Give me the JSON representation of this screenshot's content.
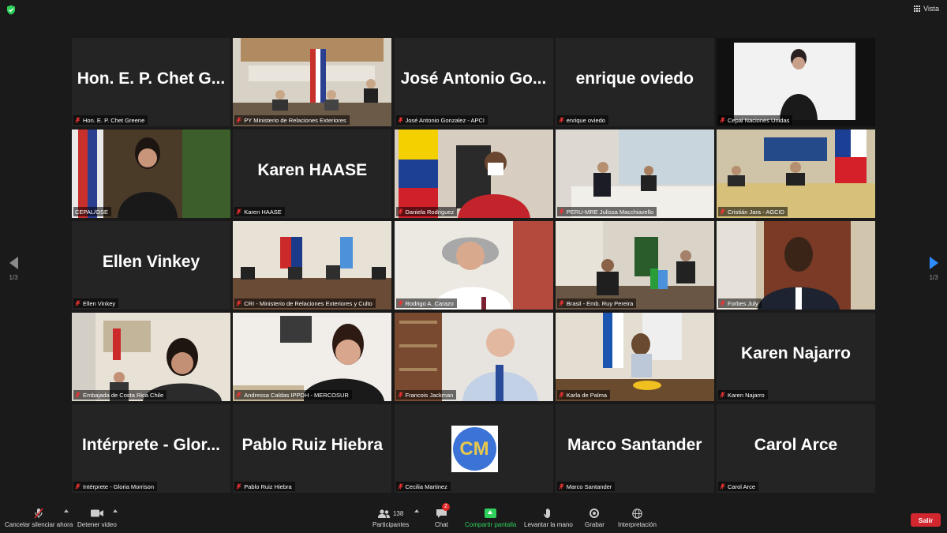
{
  "topbar": {
    "view_label": "Vista"
  },
  "pagination": {
    "left": "1/3",
    "right": "1/3"
  },
  "tiles": [
    {
      "big_name": "Hon. E. P. Chet G...",
      "label": "Hon. E. P. Chet Greene",
      "type": "name"
    },
    {
      "label": "PY Ministerio de Relaciones Exteriores",
      "type": "video"
    },
    {
      "big_name": "José Antonio Go...",
      "label": "José Antonio Gonzalez - APCI",
      "type": "name"
    },
    {
      "big_name": "enrique oviedo",
      "label": "enrique oviedo",
      "type": "name"
    },
    {
      "label": "Cepal Naciones Unidas",
      "type": "video"
    },
    {
      "label": "CEPAL/OSE",
      "type": "video",
      "active": true
    },
    {
      "big_name": "Karen HAASE",
      "label": "Karen HAASE",
      "type": "name"
    },
    {
      "label": "Daniela Rodriguez",
      "type": "video"
    },
    {
      "label": "PERU-MRE Julissa Macchiavello",
      "type": "video"
    },
    {
      "label": "Cristián Jara - AGCID",
      "type": "video"
    },
    {
      "big_name": "Ellen Vinkey",
      "label": "Ellen Vinkey",
      "type": "name"
    },
    {
      "label": "CRI - Ministerio de Relaciones Exteriores y Culto",
      "type": "video"
    },
    {
      "label": "Rodrigo A. Carazo",
      "type": "video"
    },
    {
      "label": "Brasil - Emb. Ruy Pereira",
      "type": "video"
    },
    {
      "label": "Forbes July",
      "type": "video"
    },
    {
      "label": "Embajada de Costa Rica Chile",
      "type": "video"
    },
    {
      "label": "Andressa Caldas IPPDH - MERCOSUR",
      "type": "video"
    },
    {
      "label": "Francois Jackman",
      "type": "video"
    },
    {
      "label": "Karla de Palma",
      "type": "video"
    },
    {
      "big_name": "Karen Najarro",
      "label": "Karen Najarro",
      "type": "name"
    },
    {
      "big_name": "Intérprete - Glor...",
      "label": "Intérprete - Gloria Morrison",
      "type": "name"
    },
    {
      "big_name": "Pablo Ruiz Hiebra",
      "label": "Pablo Ruiz Hiebra",
      "type": "name"
    },
    {
      "avatar_text": "CM",
      "label": "Cecilia Martinez",
      "type": "avatar"
    },
    {
      "big_name": "Marco Santander",
      "label": "Marco Santander",
      "type": "name"
    },
    {
      "big_name": "Carol Arce",
      "label": "Carol Arce",
      "type": "name"
    }
  ],
  "toolbar": {
    "mute_label": "Cancelar silenciar ahora",
    "video_label": "Detener video",
    "participants_label": "Participantes",
    "participants_count": "138",
    "chat_label": "Chat",
    "chat_badge": "2",
    "share_label": "Compartir pantalla",
    "hand_label": "Levantar la mano",
    "record_label": "Grabar",
    "interp_label": "Interpretación",
    "leave_label": "Salir"
  },
  "colors": {
    "accent_blue": "#2d8cff",
    "share_green": "#2fd05b",
    "leave_red": "#d3272f",
    "active_speaker": "#e8d548"
  }
}
